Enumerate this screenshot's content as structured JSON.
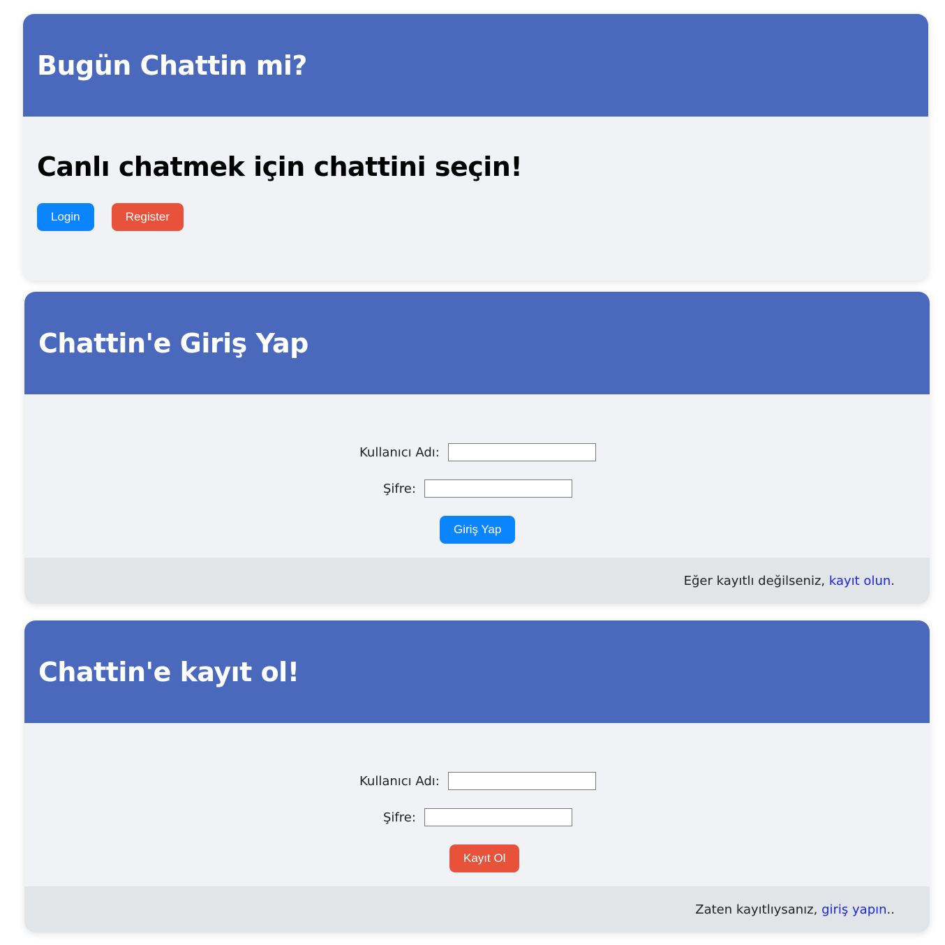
{
  "hero": {
    "title": "Bugün Chattin mi?",
    "subtitle": "Canlı chatmek için chattini seçin!",
    "login_button": "Login",
    "register_button": "Register"
  },
  "login": {
    "title": "Chattin'e Giriş Yap",
    "username_label": "Kullanıcı Adı:",
    "password_label": "Şifre:",
    "username_value": "",
    "password_value": "",
    "submit": "Giriş Yap",
    "footer_text": "Eğer kayıtlı değilseniz, ",
    "footer_link": "kayıt olun",
    "footer_suffix": "."
  },
  "register": {
    "title": "Chattin'e kayıt ol!",
    "username_label": "Kullanıcı Adı:",
    "password_label": "Şifre:",
    "username_value": "",
    "password_value": "",
    "submit": "Kayıt Ol",
    "footer_text": "Zaten kayıtlıysanız, ",
    "footer_link": "giriş yapın",
    "footer_suffix": ".."
  },
  "colors": {
    "header": "#4a69bd",
    "card_bg": "#f1f2f5",
    "footer_bg": "#e2e5e8",
    "primary": "#0a84ff",
    "danger": "#e8523a",
    "link": "#1a25e0"
  }
}
